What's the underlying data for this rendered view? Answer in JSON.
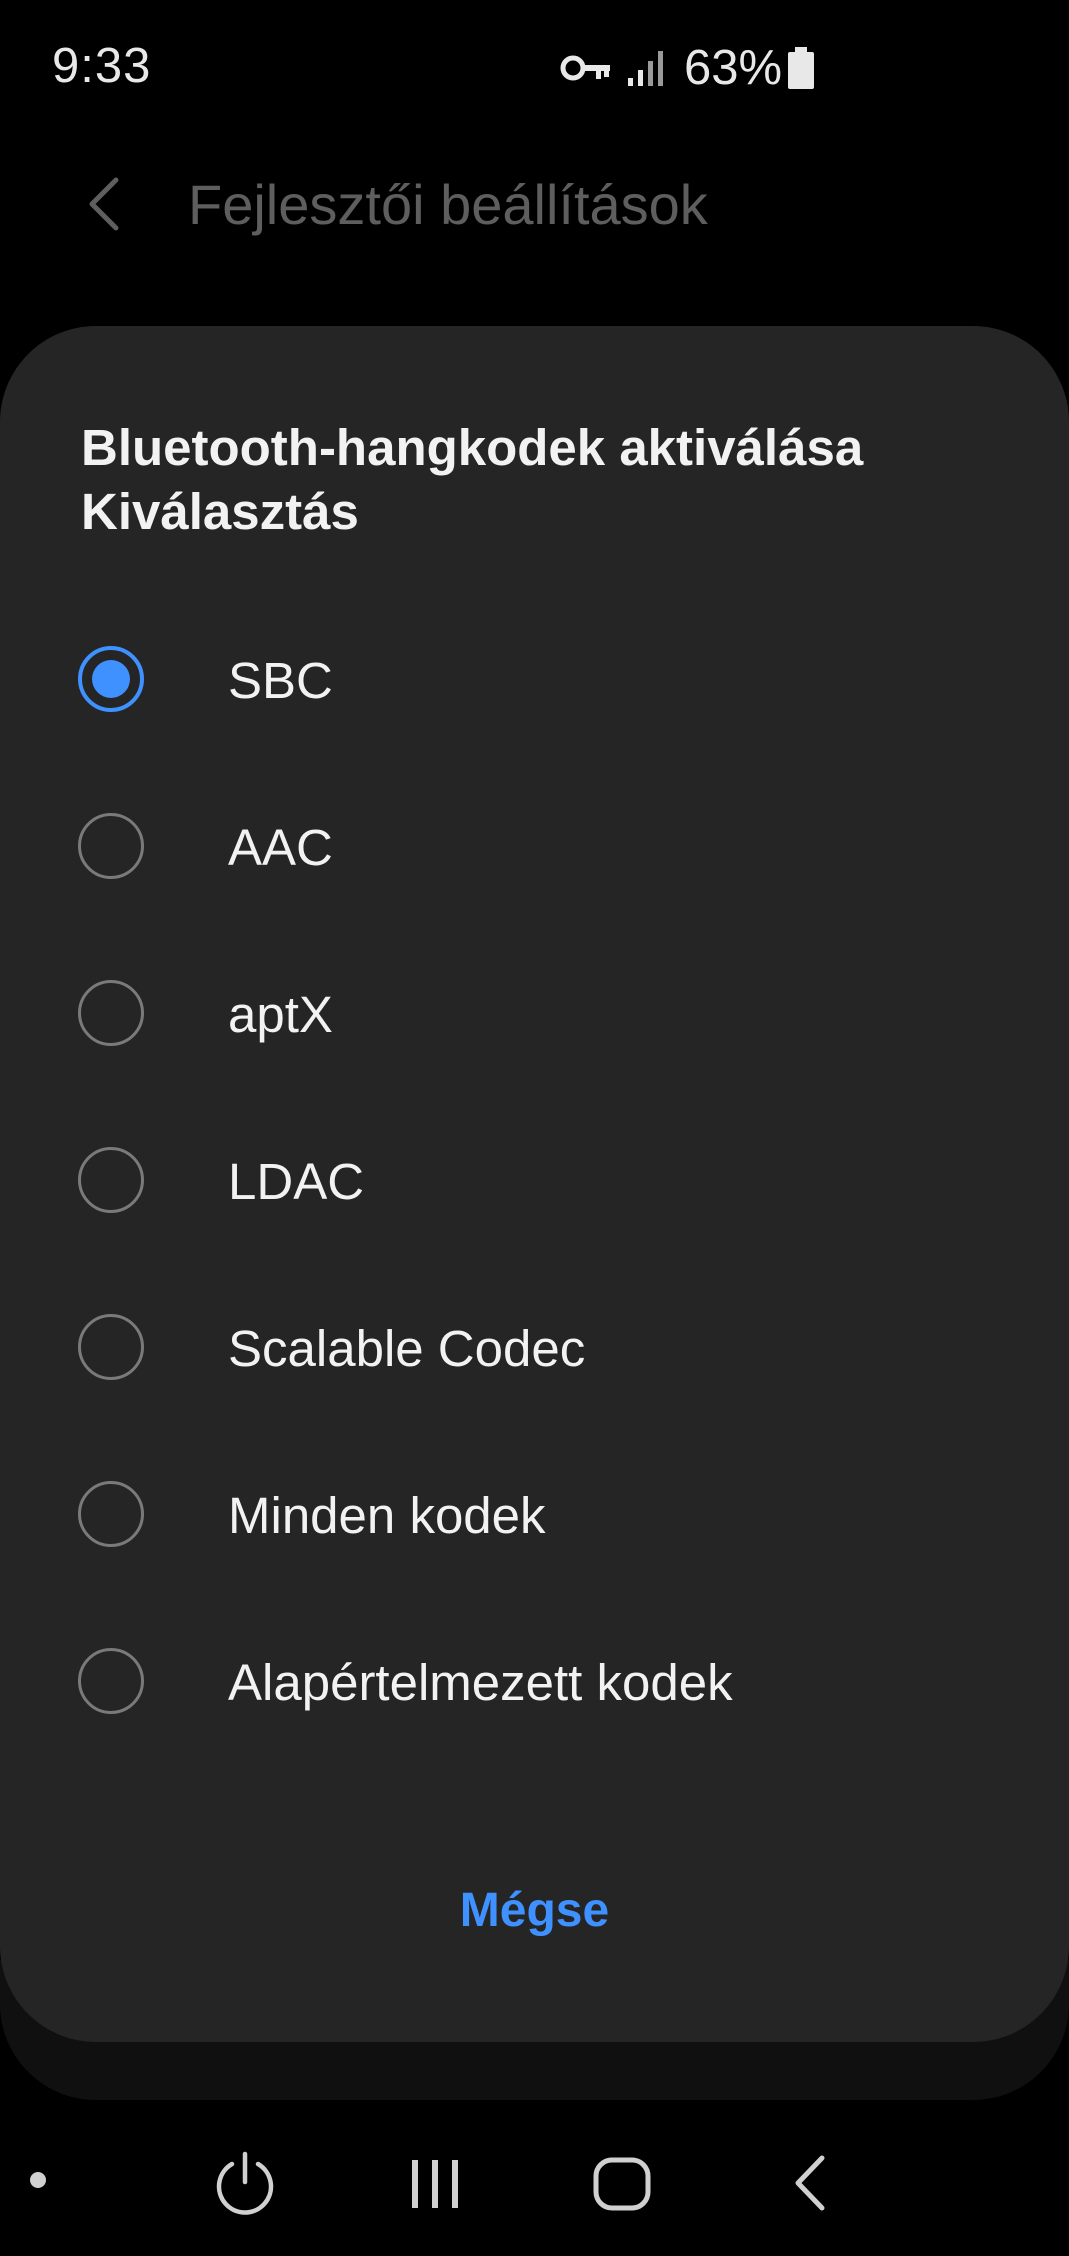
{
  "status_bar": {
    "time": "9:33",
    "battery_percent": "63%",
    "icons": [
      "vpn-key-icon",
      "signal-icon",
      "battery-icon"
    ]
  },
  "background": {
    "title": "Fejlesztői beállítások",
    "back_icon": "chevron-left-icon"
  },
  "dialog": {
    "title_line1": "Bluetooth-hangkodek aktiválása",
    "title_line2": "Kiválasztás",
    "options": [
      {
        "label": "SBC",
        "selected": true
      },
      {
        "label": "AAC",
        "selected": false
      },
      {
        "label": "aptX",
        "selected": false
      },
      {
        "label": "LDAC",
        "selected": false
      },
      {
        "label": "Scalable Codec",
        "selected": false
      },
      {
        "label": "Minden kodek",
        "selected": false
      },
      {
        "label": "Alapértelmezett kodek",
        "selected": false
      }
    ],
    "cancel_label": "Mégse"
  },
  "nav_bar": {
    "icons": [
      "dot-icon",
      "power-icon",
      "recents-icon",
      "home-icon",
      "back-icon"
    ]
  },
  "colors": {
    "accent": "#3e91ff",
    "dialog_bg": "#252525",
    "screen_bg": "#000000"
  }
}
